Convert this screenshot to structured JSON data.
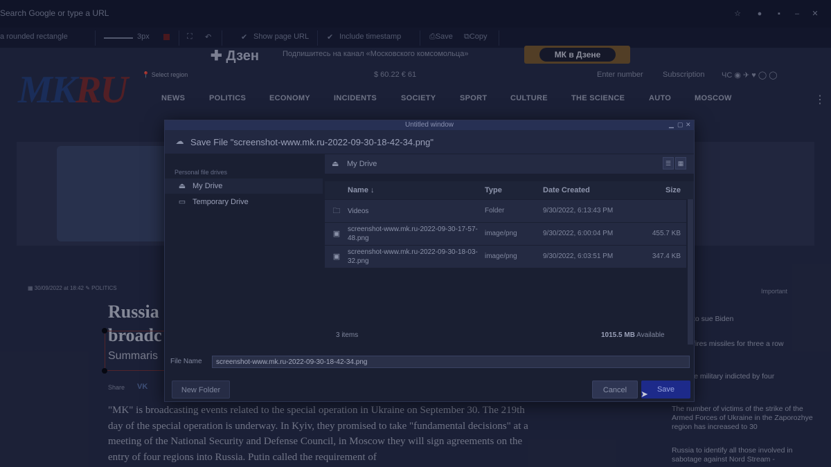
{
  "browser": {
    "url_placeholder": "Search Google or type a URL"
  },
  "screenshot_toolbar": {
    "shape_label": "a rounded rectangle",
    "stroke_width": "3px",
    "show_page_url": "Show page URL",
    "include_timestamp": "Include timestamp",
    "save_label": "Save",
    "copy_label": "Copy"
  },
  "page": {
    "banner_logo": "Дзен",
    "banner_text": "Подпишитесь на канал «Московского комсомольца»",
    "banner_button": "МК в Дзене",
    "logo_mk": "MK",
    "logo_ru": "RU",
    "region": "Select region",
    "rates": "$ 60.22 € 61",
    "enter_number": "Enter number",
    "subscription": "Subscription",
    "nav": [
      "NEWS",
      "POLITICS",
      "ECONOMY",
      "INCIDENTS",
      "SOCIETY",
      "SPORT",
      "CULTURE",
      "THE SCIENCE",
      "AUTO",
      "MOSCOW"
    ],
    "meta_date": "30/09/2022 at 18:42",
    "meta_category": "POLITICS",
    "headline_1": "Russia",
    "headline_2": "broadc",
    "summary": "Summaris",
    "social_label": "Share",
    "social_vk": "VK",
    "body": "\"MK\" is broadcasting events related to the special operation in Ukraine on September 30. The 219th day of the special operation is underway. In Kyiv, they promised to take \"fundamental decisions\" at a meeting of the National Security and Defense Council, in Moscow they will sign agreements on the entry of four regions into Russia. Putin called the requirement of",
    "sidebar": {
      "heading": "Important",
      "items": [
        {
          "text": "states to sue Biden"
        },
        {
          "text": "Korea fires missiles for three a row"
        },
        {
          "text": "rs of the military indicted by four"
        },
        {
          "text": "The number of victims of the strike of the Armed Forces of Ukraine in the Zaporozhye region has increased to 30"
        },
        {
          "text": "Russia to identify all those involved in sabotage against Nord Stream -"
        }
      ]
    }
  },
  "dialog": {
    "window_title": "Untitled window",
    "title": "Save File \"screenshot-www.mk.ru-2022-09-30-18-42-34.png\"",
    "places_label": "Personal file drives",
    "places": [
      {
        "label": "My Drive",
        "icon": "drive-icon",
        "selected": true
      },
      {
        "label": "Temporary Drive",
        "icon": "hard-drive-icon",
        "selected": false
      }
    ],
    "path": "My Drive",
    "columns": {
      "name": "Name ↓",
      "type": "Type",
      "date": "Date Created",
      "size": "Size"
    },
    "files": [
      {
        "name": "Videos",
        "type": "Folder",
        "date": "9/30/2022, 6:13:43 PM",
        "size": "",
        "icon": "folder-icon"
      },
      {
        "name": "screenshot-www.mk.ru-2022-09-30-17-57-48.png",
        "type": "image/png",
        "date": "9/30/2022, 6:00:04 PM",
        "size": "455.7 KB",
        "icon": "image-file-icon"
      },
      {
        "name": "screenshot-www.mk.ru-2022-09-30-18-03-32.png",
        "type": "image/png",
        "date": "9/30/2022, 6:03:51 PM",
        "size": "347.4 KB",
        "icon": "image-file-icon"
      }
    ],
    "item_count": "3 items",
    "available_value": "1015.5 MB",
    "available_label": "Available",
    "filename_label": "File Name",
    "filename_value": "screenshot-www.mk.ru-2022-09-30-18-42-34.png",
    "new_folder": "New Folder",
    "cancel": "Cancel",
    "save": "Save"
  },
  "colors": {
    "save_button": "#1d2a8a",
    "dialog_bg": "#1a1f32",
    "logo_blue": "#24407a",
    "logo_red": "#7a2a2a"
  }
}
